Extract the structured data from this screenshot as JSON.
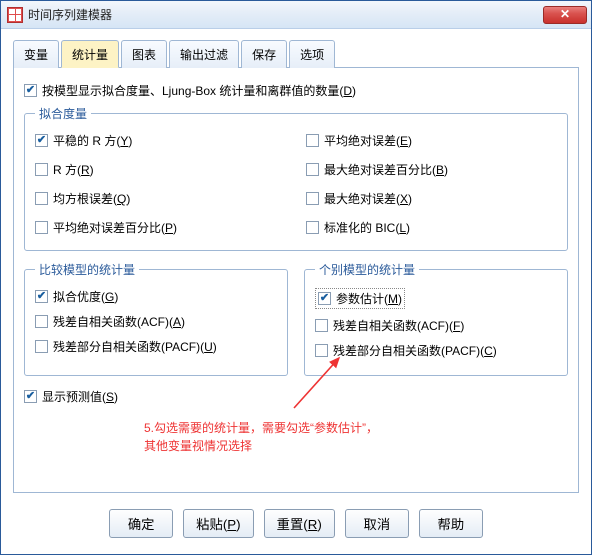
{
  "window": {
    "title": "时间序列建模器"
  },
  "tabs": [
    "变量",
    "统计量",
    "图表",
    "输出过滤",
    "保存",
    "选项"
  ],
  "active_tab_index": 1,
  "main_check": {
    "label": "按模型显示拟合度量、Ljung-Box 统计量和离群值的数量(",
    "key": "D",
    "tail": ")",
    "checked": true
  },
  "fit": {
    "legend": "拟合度量",
    "items": [
      {
        "label": "平稳的 R 方(",
        "key": "Y",
        "tail": ")",
        "checked": true
      },
      {
        "label": "平均绝对误差(",
        "key": "E",
        "tail": ")",
        "checked": false
      },
      {
        "label": "R 方(",
        "key": "R",
        "tail": ")",
        "checked": false
      },
      {
        "label": "最大绝对误差百分比(",
        "key": "B",
        "tail": ")",
        "checked": false
      },
      {
        "label": "均方根误差(",
        "key": "Q",
        "tail": ")",
        "checked": false
      },
      {
        "label": "最大绝对误差(",
        "key": "X",
        "tail": ")",
        "checked": false
      },
      {
        "label": "平均绝对误差百分比(",
        "key": "P",
        "tail": ")",
        "checked": false
      },
      {
        "label": "标准化的 BIC(",
        "key": "L",
        "tail": ")",
        "checked": false
      }
    ]
  },
  "compare": {
    "legend": "比较模型的统计量",
    "items": [
      {
        "label": "拟合优度(",
        "key": "G",
        "tail": ")",
        "checked": true
      },
      {
        "label": "残差自相关函数(ACF)(",
        "key": "A",
        "tail": ")",
        "checked": false
      },
      {
        "label": "残差部分自相关函数(PACF)(",
        "key": "U",
        "tail": ")",
        "checked": false
      }
    ]
  },
  "individual": {
    "legend": "个别模型的统计量",
    "items": [
      {
        "label": "参数估计(",
        "key": "M",
        "tail": ")",
        "checked": true,
        "highlight": true
      },
      {
        "label": "残差自相关函数(ACF)(",
        "key": "F",
        "tail": ")",
        "checked": false
      },
      {
        "label": "残差部分自相关函数(PACF)(",
        "key": "C",
        "tail": ")",
        "checked": false
      }
    ]
  },
  "forecast": {
    "label": "显示预测值(",
    "key": "S",
    "tail": ")",
    "checked": true
  },
  "annotation": {
    "line1": "5.勾选需要的统计量，需要勾选“参数估计”，",
    "line2": "其他变量视情况选择"
  },
  "buttons": {
    "ok": "确定",
    "paste": "粘贴(",
    "paste_key": "P",
    "paste_tail": ")",
    "reset": "重置(",
    "reset_key": "R",
    "reset_tail": ")",
    "cancel": "取消",
    "help": "帮助"
  }
}
